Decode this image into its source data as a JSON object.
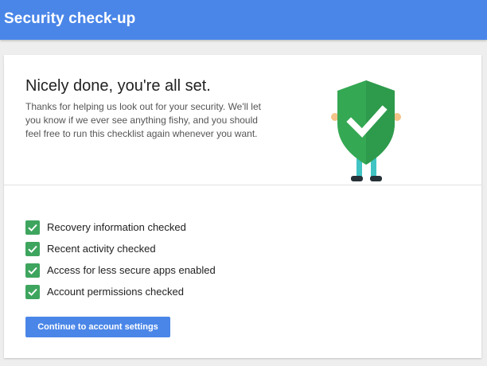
{
  "header": {
    "title": "Security check-up"
  },
  "main": {
    "heading": "Nicely done, you're all set.",
    "description": "Thanks for helping us look out for your security. We'll let you know if we ever see anything fishy, and you should feel free to run this checklist again whenever you want.",
    "checklist": [
      {
        "label": "Recovery information checked",
        "checked": true
      },
      {
        "label": "Recent activity checked",
        "checked": true
      },
      {
        "label": "Access for less secure apps enabled",
        "checked": true
      },
      {
        "label": "Account permissions checked",
        "checked": true
      }
    ],
    "continue_label": "Continue to account settings"
  },
  "icons": {
    "illustration": "shield-with-checkmark-icon",
    "checkbox": "checkmark-icon"
  },
  "colors": {
    "header_bg": "#4a86e8",
    "button_bg": "#4a86e8",
    "check_green": "#3ea55e",
    "shield_green": "#34a853"
  }
}
